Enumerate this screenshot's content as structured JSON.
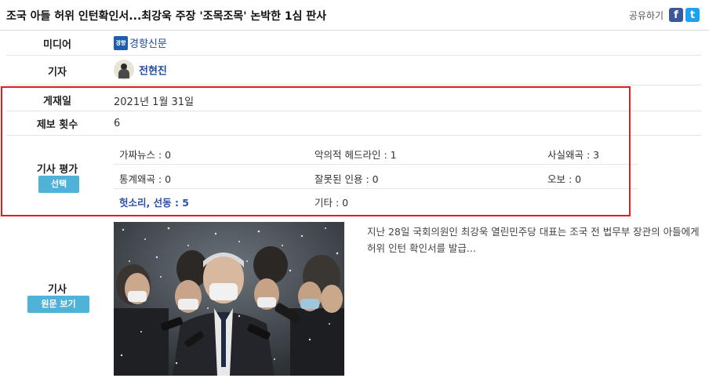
{
  "header": {
    "title": "조국 아들 허위 인턴확인서...최강욱 주장 '조목조목' 논박한 1심 판사",
    "share_label": "공유하기",
    "facebook_glyph": "f",
    "twitter_glyph": "t"
  },
  "media": {
    "label": "미디어",
    "logo_text": "경향",
    "name": "경향신문"
  },
  "reporter": {
    "label": "기자",
    "name": "전현진"
  },
  "publish": {
    "label": "게재일",
    "date": "2021년 1월 31일"
  },
  "report_count": {
    "label": "제보 횟수",
    "value": "6"
  },
  "evaluation": {
    "label": "기사 평가",
    "button": "선택",
    "items": [
      {
        "text": "가짜뉴스 : 0"
      },
      {
        "text": "악의적 헤드라인 : 1"
      },
      {
        "text": "사실왜곡 : 3"
      },
      {
        "text": "통계왜곡 : 0"
      },
      {
        "text": "잘못된 인용 : 0"
      },
      {
        "text": "오보 : 0"
      },
      {
        "text": "헛소리, 선동 : 5"
      },
      {
        "text": "기타 : 0"
      }
    ]
  },
  "article": {
    "label": "기사",
    "button": "원문 보기",
    "summary": "지난 28일 국회의원인 최강욱 열린민주당 대표는 조국 전 법무부 장관의 아들에게 허위 인턴 확인서를 발급..."
  },
  "colors": {
    "highlight_box": "#e01e1e",
    "button_blue": "#4fb2d6",
    "link_blue": "#1d4c9e"
  }
}
